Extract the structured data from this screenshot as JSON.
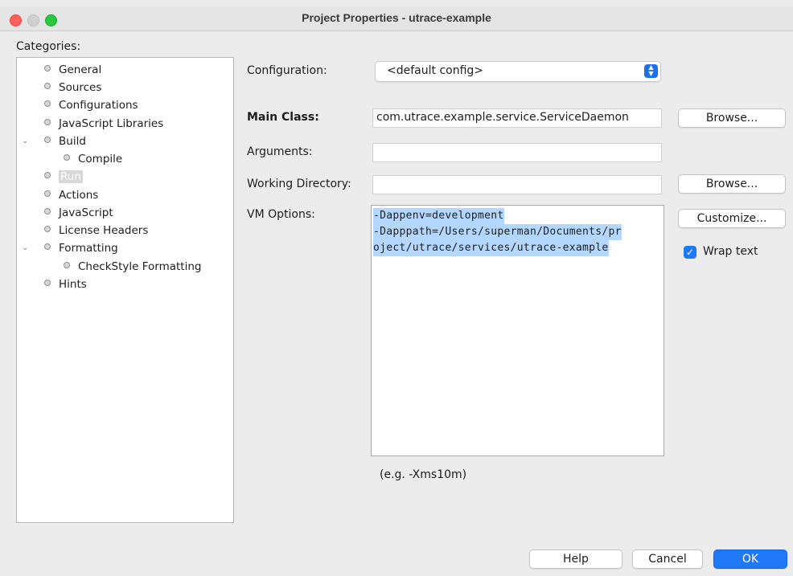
{
  "window": {
    "title": "Project Properties - utrace-example"
  },
  "categories": {
    "label": "Categories:",
    "items": [
      {
        "label": "General"
      },
      {
        "label": "Sources"
      },
      {
        "label": "Configurations"
      },
      {
        "label": "JavaScript Libraries"
      },
      {
        "label": "Build",
        "expanded": true
      },
      {
        "label": "Compile"
      },
      {
        "label": "Run",
        "selected": true
      },
      {
        "label": "Actions"
      },
      {
        "label": "JavaScript"
      },
      {
        "label": "License Headers"
      },
      {
        "label": "Formatting",
        "expanded": true
      },
      {
        "label": "CheckStyle Formatting"
      },
      {
        "label": "Hints"
      }
    ]
  },
  "form": {
    "configuration_label": "Configuration:",
    "configuration_value": "<default config>",
    "main_class_label": "Main Class:",
    "main_class_value": "com.utrace.example.service.ServiceDaemon",
    "arguments_label": "Arguments:",
    "arguments_value": "",
    "working_dir_label": "Working Directory:",
    "working_dir_value": "",
    "vm_options_label": "VM Options:",
    "vm_options_lines": [
      "-Dappenv=development",
      "-Dapppath=/Users/superman/Documents/pr",
      "oject/utrace/services/utrace-example"
    ],
    "vm_hint": "(e.g. -Xms10m)",
    "wrap_text_label": "Wrap text",
    "wrap_text_checked": true
  },
  "buttons": {
    "browse_main": "Browse...",
    "browse_dir": "Browse...",
    "customize": "Customize...",
    "help": "Help",
    "cancel": "Cancel",
    "ok": "OK"
  },
  "colors": {
    "accent": "#1f78f5",
    "selection": "#b3d7ff"
  }
}
